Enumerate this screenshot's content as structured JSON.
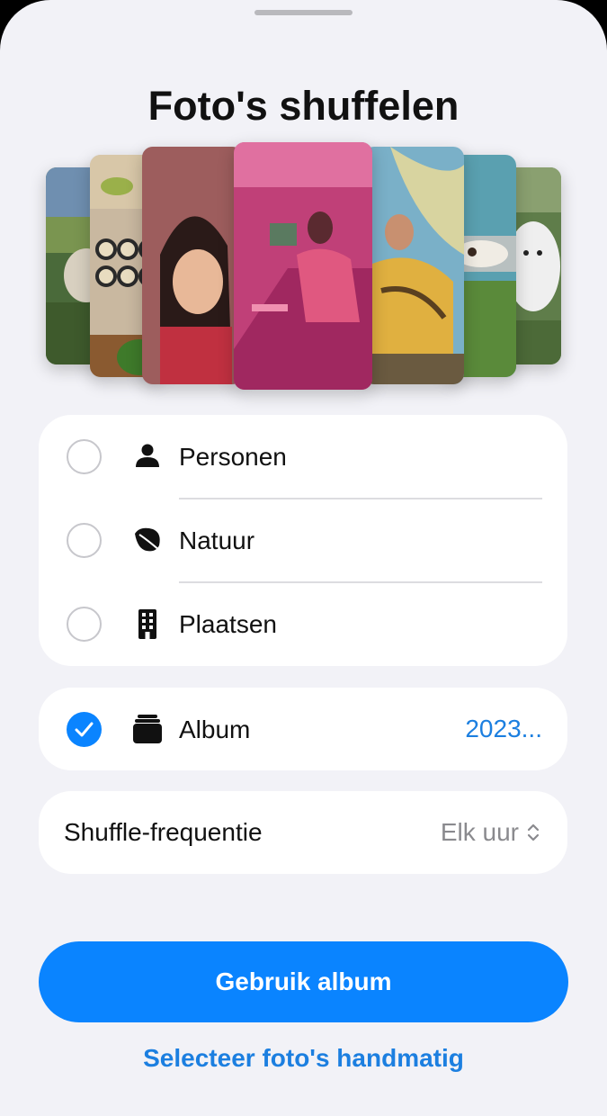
{
  "sheet": {
    "title": "Foto's shuffelen"
  },
  "preview": {
    "photos": [
      {
        "name": "landscape-dog-photo"
      },
      {
        "name": "sushi-photo"
      },
      {
        "name": "portrait-woman-photo"
      },
      {
        "name": "diner-pink-photo"
      },
      {
        "name": "colorful-portrait-photo"
      },
      {
        "name": "cow-field-photo"
      },
      {
        "name": "white-dog-photo"
      }
    ]
  },
  "categories": {
    "items": [
      {
        "label": "Personen",
        "icon": "person-icon",
        "selected": false
      },
      {
        "label": "Natuur",
        "icon": "leaf-icon",
        "selected": false
      },
      {
        "label": "Plaatsen",
        "icon": "building-icon",
        "selected": false
      }
    ]
  },
  "album": {
    "label": "Album",
    "value": "2023...",
    "icon": "album-stack-icon",
    "selected": true
  },
  "frequency": {
    "label": "Shuffle-frequentie",
    "value": "Elk uur",
    "icon": "chevron-up-down-icon"
  },
  "actions": {
    "primary_label": "Gebruik album",
    "secondary_label": "Selecteer foto's handmatig"
  },
  "colors": {
    "accent": "#0a84ff",
    "link": "#1c7fe0",
    "background": "#f2f2f7"
  }
}
